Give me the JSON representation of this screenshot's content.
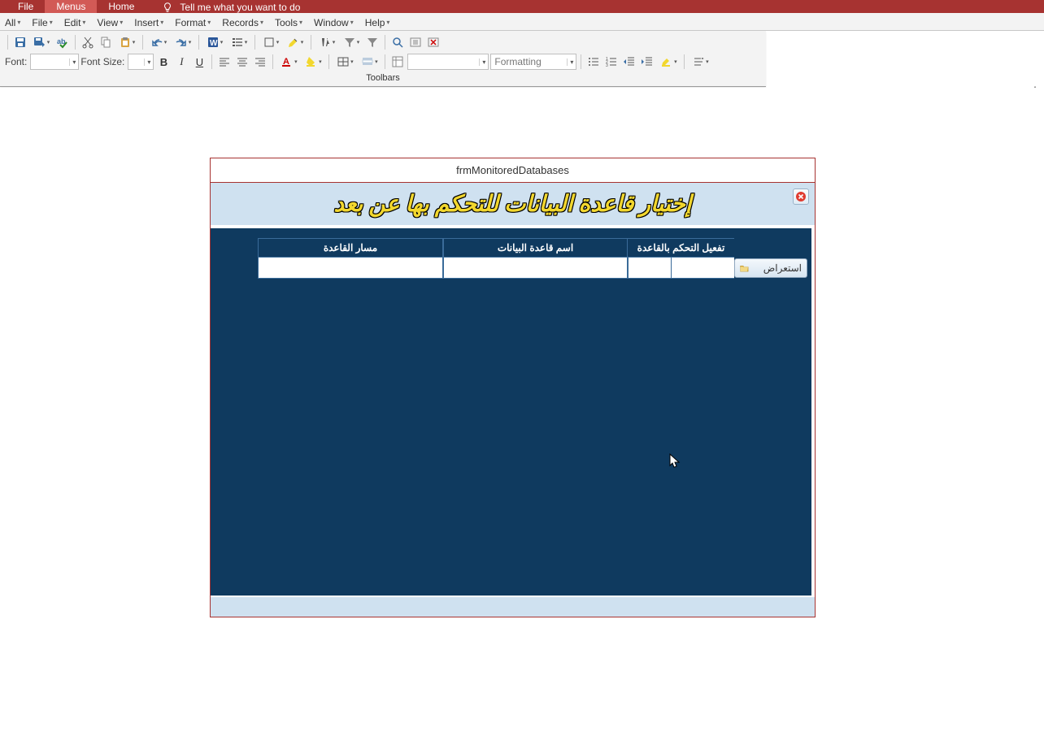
{
  "ribbon": {
    "tabs": [
      "File",
      "Menus",
      "Home"
    ],
    "active": 1,
    "tellme": "Tell me what you want to do"
  },
  "menus": [
    "All",
    "File",
    "Edit",
    "View",
    "Insert",
    "Format",
    "Records",
    "Tools",
    "Window",
    "Help"
  ],
  "toolbar": {
    "font_label": "Font:",
    "font_size_label": "Font Size:",
    "formatting_placeholder": "Formatting",
    "group_label": "Toolbars"
  },
  "form": {
    "window_title": "frmMonitoredDatabases",
    "header_title_ar": "إختيار قاعدة البيانات للتحكم بها عن بعد",
    "columns": {
      "enable": "تفعيل التحكم بالقاعدة",
      "db_name": "اسم قاعدة البيانات",
      "db_path": "مسار القاعدة"
    },
    "browse_label": "استعراض",
    "rows": [
      {
        "path": "",
        "name": "",
        "enabled": ""
      }
    ]
  }
}
